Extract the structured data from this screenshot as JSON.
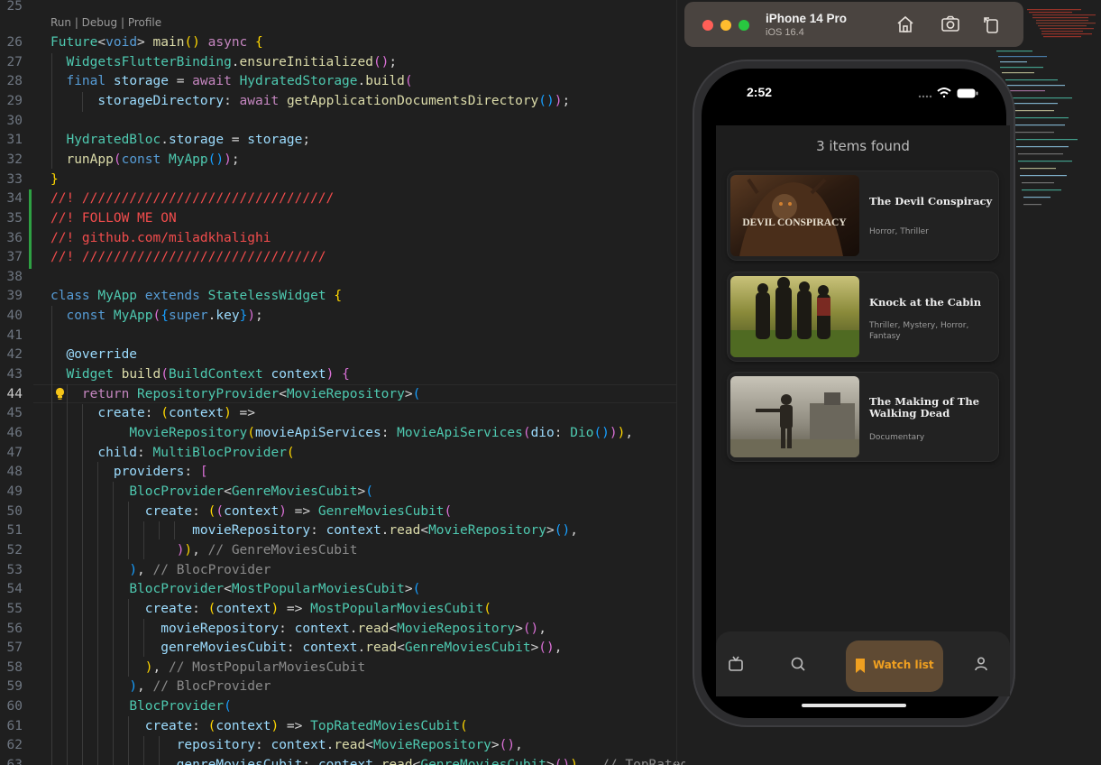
{
  "editor": {
    "codelens": "Run | Debug | Profile",
    "active_line": "44",
    "lines": [
      {
        "n": "25",
        "tokens": []
      },
      {
        "n": "26",
        "tokens": [
          [
            "t",
            "Future"
          ],
          [
            "w",
            "<"
          ],
          [
            "k",
            "void"
          ],
          [
            "w",
            "> "
          ],
          [
            "f",
            "main"
          ],
          [
            "y",
            "()"
          ],
          [
            "w",
            " "
          ],
          [
            "c",
            "async"
          ],
          [
            "w",
            " "
          ],
          [
            "y",
            "{"
          ]
        ]
      },
      {
        "n": "27",
        "tokens": [
          [
            "w",
            "  "
          ],
          [
            "t",
            "WidgetsFlutterBinding"
          ],
          [
            "w",
            "."
          ],
          [
            "f",
            "ensureInitialized"
          ],
          [
            "p",
            "()"
          ],
          [
            "w",
            ";"
          ]
        ]
      },
      {
        "n": "28",
        "tokens": [
          [
            "w",
            "  "
          ],
          [
            "k",
            "final"
          ],
          [
            "w",
            " "
          ],
          [
            "v",
            "storage"
          ],
          [
            "w",
            " = "
          ],
          [
            "c",
            "await"
          ],
          [
            "w",
            " "
          ],
          [
            "t",
            "HydratedStorage"
          ],
          [
            "w",
            "."
          ],
          [
            "f",
            "build"
          ],
          [
            "p",
            "("
          ]
        ]
      },
      {
        "n": "29",
        "tokens": [
          [
            "w",
            "      "
          ],
          [
            "v",
            "storageDirectory"
          ],
          [
            "w",
            ": "
          ],
          [
            "c",
            "await"
          ],
          [
            "w",
            " "
          ],
          [
            "f",
            "getApplicationDocumentsDirectory"
          ],
          [
            "b",
            "()"
          ],
          [
            "p",
            ")"
          ],
          [
            "w",
            ";"
          ]
        ]
      },
      {
        "n": "30",
        "tokens": []
      },
      {
        "n": "31",
        "tokens": [
          [
            "w",
            "  "
          ],
          [
            "t",
            "HydratedBloc"
          ],
          [
            "w",
            "."
          ],
          [
            "v",
            "storage"
          ],
          [
            "w",
            " = "
          ],
          [
            "v",
            "storage"
          ],
          [
            "w",
            ";"
          ]
        ]
      },
      {
        "n": "32",
        "tokens": [
          [
            "w",
            "  "
          ],
          [
            "f",
            "runApp"
          ],
          [
            "p",
            "("
          ],
          [
            "k",
            "const"
          ],
          [
            "w",
            " "
          ],
          [
            "t",
            "MyApp"
          ],
          [
            "b",
            "()"
          ],
          [
            "p",
            ")"
          ],
          [
            "w",
            ";"
          ]
        ]
      },
      {
        "n": "33",
        "tokens": [
          [
            "y",
            "}"
          ]
        ]
      },
      {
        "n": "34",
        "tokens": [
          [
            "r",
            "//! ////////////////////////////////"
          ]
        ]
      },
      {
        "n": "35",
        "tokens": [
          [
            "r",
            "//! FOLLOW ME ON"
          ]
        ]
      },
      {
        "n": "36",
        "tokens": [
          [
            "r",
            "//! github.com/miladkhalighi"
          ]
        ]
      },
      {
        "n": "37",
        "tokens": [
          [
            "r",
            "//! ///////////////////////////////"
          ]
        ]
      },
      {
        "n": "38",
        "tokens": []
      },
      {
        "n": "39",
        "tokens": [
          [
            "k",
            "class"
          ],
          [
            "w",
            " "
          ],
          [
            "t",
            "MyApp"
          ],
          [
            "w",
            " "
          ],
          [
            "k",
            "extends"
          ],
          [
            "w",
            " "
          ],
          [
            "t",
            "StatelessWidget"
          ],
          [
            "w",
            " "
          ],
          [
            "y",
            "{"
          ]
        ]
      },
      {
        "n": "40",
        "tokens": [
          [
            "w",
            "  "
          ],
          [
            "k",
            "const"
          ],
          [
            "w",
            " "
          ],
          [
            "t",
            "MyApp"
          ],
          [
            "p",
            "("
          ],
          [
            "b",
            "{"
          ],
          [
            "k",
            "super"
          ],
          [
            "w",
            "."
          ],
          [
            "v",
            "key"
          ],
          [
            "b",
            "}"
          ],
          [
            "p",
            ")"
          ],
          [
            "w",
            ";"
          ]
        ]
      },
      {
        "n": "41",
        "tokens": []
      },
      {
        "n": "42",
        "tokens": [
          [
            "w",
            "  "
          ],
          [
            "v",
            "@override"
          ]
        ]
      },
      {
        "n": "43",
        "tokens": [
          [
            "w",
            "  "
          ],
          [
            "t",
            "Widget"
          ],
          [
            "w",
            " "
          ],
          [
            "f",
            "build"
          ],
          [
            "p",
            "("
          ],
          [
            "t",
            "BuildContext"
          ],
          [
            "w",
            " "
          ],
          [
            "v",
            "context"
          ],
          [
            "p",
            ")"
          ],
          [
            "w",
            " "
          ],
          [
            "p",
            "{"
          ]
        ]
      },
      {
        "n": "44",
        "tokens": [
          [
            "w",
            "    "
          ],
          [
            "c",
            "return"
          ],
          [
            "w",
            " "
          ],
          [
            "t",
            "RepositoryProvider"
          ],
          [
            "w",
            "<"
          ],
          [
            "t",
            "MovieRepository"
          ],
          [
            "w",
            ">"
          ],
          [
            "b",
            "("
          ]
        ]
      },
      {
        "n": "45",
        "tokens": [
          [
            "w",
            "      "
          ],
          [
            "v",
            "create"
          ],
          [
            "w",
            ": "
          ],
          [
            "y",
            "("
          ],
          [
            "v",
            "context"
          ],
          [
            "y",
            ")"
          ],
          [
            "w",
            " =>"
          ]
        ]
      },
      {
        "n": "46",
        "tokens": [
          [
            "w",
            "          "
          ],
          [
            "t",
            "MovieRepository"
          ],
          [
            "y",
            "("
          ],
          [
            "v",
            "movieApiServices"
          ],
          [
            "w",
            ": "
          ],
          [
            "t",
            "MovieApiServices"
          ],
          [
            "p",
            "("
          ],
          [
            "v",
            "dio"
          ],
          [
            "w",
            ": "
          ],
          [
            "t",
            "Dio"
          ],
          [
            "b",
            "()"
          ],
          [
            "p",
            ")"
          ],
          [
            "y",
            ")"
          ],
          [
            "w",
            ","
          ]
        ]
      },
      {
        "n": "47",
        "tokens": [
          [
            "w",
            "      "
          ],
          [
            "v",
            "child"
          ],
          [
            "w",
            ": "
          ],
          [
            "t",
            "MultiBlocProvider"
          ],
          [
            "y",
            "("
          ]
        ]
      },
      {
        "n": "48",
        "tokens": [
          [
            "w",
            "        "
          ],
          [
            "v",
            "providers"
          ],
          [
            "w",
            ": "
          ],
          [
            "p",
            "["
          ]
        ]
      },
      {
        "n": "49",
        "tokens": [
          [
            "w",
            "          "
          ],
          [
            "t",
            "BlocProvider"
          ],
          [
            "w",
            "<"
          ],
          [
            "t",
            "GenreMoviesCubit"
          ],
          [
            "w",
            ">"
          ],
          [
            "b",
            "("
          ]
        ]
      },
      {
        "n": "50",
        "tokens": [
          [
            "w",
            "            "
          ],
          [
            "v",
            "create"
          ],
          [
            "w",
            ": "
          ],
          [
            "y",
            "("
          ],
          [
            "p",
            "("
          ],
          [
            "v",
            "context"
          ],
          [
            "p",
            ")"
          ],
          [
            "w",
            " => "
          ],
          [
            "t",
            "GenreMoviesCubit"
          ],
          [
            "p",
            "("
          ]
        ]
      },
      {
        "n": "51",
        "tokens": [
          [
            "w",
            "                  "
          ],
          [
            "v",
            "movieRepository"
          ],
          [
            "w",
            ": "
          ],
          [
            "v",
            "context"
          ],
          [
            "w",
            "."
          ],
          [
            "f",
            "read"
          ],
          [
            "w",
            "<"
          ],
          [
            "t",
            "MovieRepository"
          ],
          [
            "w",
            ">"
          ],
          [
            "b",
            "()"
          ],
          [
            "w",
            ","
          ]
        ]
      },
      {
        "n": "52",
        "tokens": [
          [
            "w",
            "                "
          ],
          [
            "p",
            ")"
          ],
          [
            "y",
            ")"
          ],
          [
            "w",
            ", "
          ],
          [
            "g",
            "// GenreMoviesCubit"
          ]
        ]
      },
      {
        "n": "53",
        "tokens": [
          [
            "w",
            "          "
          ],
          [
            "b",
            ")"
          ],
          [
            "w",
            ", "
          ],
          [
            "g",
            "// BlocProvider"
          ]
        ]
      },
      {
        "n": "54",
        "tokens": [
          [
            "w",
            "          "
          ],
          [
            "t",
            "BlocProvider"
          ],
          [
            "w",
            "<"
          ],
          [
            "t",
            "MostPopularMoviesCubit"
          ],
          [
            "w",
            ">"
          ],
          [
            "b",
            "("
          ]
        ]
      },
      {
        "n": "55",
        "tokens": [
          [
            "w",
            "            "
          ],
          [
            "v",
            "create"
          ],
          [
            "w",
            ": "
          ],
          [
            "y",
            "("
          ],
          [
            "v",
            "context"
          ],
          [
            "y",
            ")"
          ],
          [
            "w",
            " => "
          ],
          [
            "t",
            "MostPopularMoviesCubit"
          ],
          [
            "y",
            "("
          ]
        ]
      },
      {
        "n": "56",
        "tokens": [
          [
            "w",
            "              "
          ],
          [
            "v",
            "movieRepository"
          ],
          [
            "w",
            ": "
          ],
          [
            "v",
            "context"
          ],
          [
            "w",
            "."
          ],
          [
            "f",
            "read"
          ],
          [
            "w",
            "<"
          ],
          [
            "t",
            "MovieRepository"
          ],
          [
            "w",
            ">"
          ],
          [
            "p",
            "()"
          ],
          [
            "w",
            ","
          ]
        ]
      },
      {
        "n": "57",
        "tokens": [
          [
            "w",
            "              "
          ],
          [
            "v",
            "genreMoviesCubit"
          ],
          [
            "w",
            ": "
          ],
          [
            "v",
            "context"
          ],
          [
            "w",
            "."
          ],
          [
            "f",
            "read"
          ],
          [
            "w",
            "<"
          ],
          [
            "t",
            "GenreMoviesCubit"
          ],
          [
            "w",
            ">"
          ],
          [
            "p",
            "()"
          ],
          [
            "w",
            ","
          ]
        ]
      },
      {
        "n": "58",
        "tokens": [
          [
            "w",
            "            "
          ],
          [
            "y",
            ")"
          ],
          [
            "w",
            ", "
          ],
          [
            "g",
            "// MostPopularMoviesCubit"
          ]
        ]
      },
      {
        "n": "59",
        "tokens": [
          [
            "w",
            "          "
          ],
          [
            "b",
            ")"
          ],
          [
            "w",
            ", "
          ],
          [
            "g",
            "// BlocProvider"
          ]
        ]
      },
      {
        "n": "60",
        "tokens": [
          [
            "w",
            "          "
          ],
          [
            "t",
            "BlocProvider"
          ],
          [
            "b",
            "("
          ]
        ]
      },
      {
        "n": "61",
        "tokens": [
          [
            "w",
            "            "
          ],
          [
            "v",
            "create"
          ],
          [
            "w",
            ": "
          ],
          [
            "y",
            "("
          ],
          [
            "v",
            "context"
          ],
          [
            "y",
            ")"
          ],
          [
            "w",
            " => "
          ],
          [
            "t",
            "TopRatedMoviesCubit"
          ],
          [
            "y",
            "("
          ]
        ]
      },
      {
        "n": "62",
        "tokens": [
          [
            "w",
            "                "
          ],
          [
            "v",
            "repository"
          ],
          [
            "w",
            ": "
          ],
          [
            "v",
            "context"
          ],
          [
            "w",
            "."
          ],
          [
            "f",
            "read"
          ],
          [
            "w",
            "<"
          ],
          [
            "t",
            "MovieRepository"
          ],
          [
            "w",
            ">"
          ],
          [
            "p",
            "()"
          ],
          [
            "w",
            ","
          ]
        ]
      },
      {
        "n": "63",
        "tokens": [
          [
            "w",
            "                "
          ],
          [
            "v",
            "genreMoviesCubit"
          ],
          [
            "w",
            ": "
          ],
          [
            "v",
            "context"
          ],
          [
            "w",
            "."
          ],
          [
            "f",
            "read"
          ],
          [
            "w",
            "<"
          ],
          [
            "t",
            "GenreMoviesCubit"
          ],
          [
            "w",
            ">"
          ],
          [
            "p",
            "()"
          ],
          [
            "y",
            ")"
          ],
          [
            "w",
            ",  "
          ],
          [
            "g",
            "// TopRatedMoviesCubit"
          ]
        ]
      }
    ]
  },
  "simulator": {
    "device": "iPhone 14 Pro",
    "os": "iOS 16.4",
    "toolbar_icons": [
      "home-icon",
      "screenshot-icon",
      "rotate-icon"
    ]
  },
  "app": {
    "status_time": "2:52",
    "results_text": "3 items found",
    "movies": [
      {
        "title": "The Devil Conspiracy",
        "genres": "Horror, Thriller",
        "poster_text": "DEVIL CONSPIRACY"
      },
      {
        "title": "Knock at the Cabin",
        "genres": "Thriller, Mystery, Horror, Fantasy"
      },
      {
        "title": "The Making of The Walking Dead",
        "genres": "Documentary"
      }
    ],
    "nav": {
      "items": [
        "tv-icon",
        "search-icon",
        "bookmark-icon",
        "profile-icon"
      ],
      "active_label": "Watch list",
      "accent": "#f0a020"
    }
  }
}
